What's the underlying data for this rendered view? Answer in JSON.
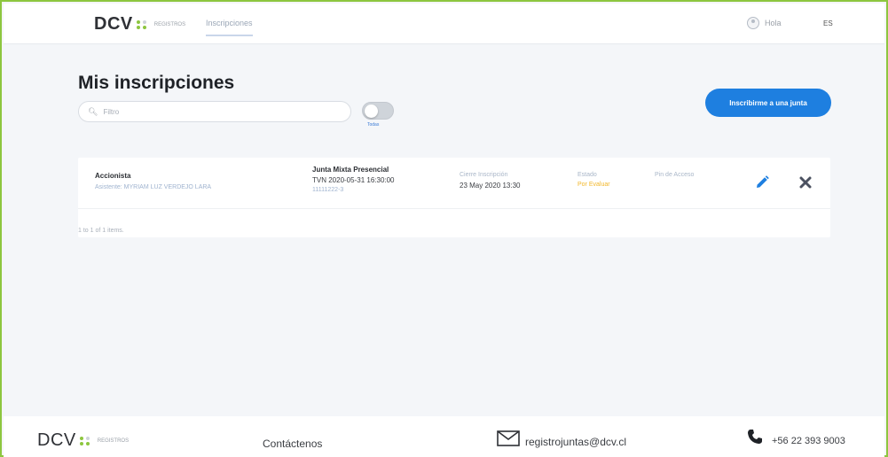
{
  "nav": {
    "logo": "DCV",
    "logo_sub": "REGISTROS",
    "tab": "Inscripciones",
    "user_label": "Hola",
    "lang": "ES"
  },
  "page": {
    "title": "Mis inscripciones",
    "search_placeholder": "Filtro",
    "toggle_label": "Todas",
    "cta": "Inscribirme a una junta"
  },
  "table": {
    "rows": [
      {
        "role": "Accionista",
        "attendee": "Asistente: MYRIAM LUZ VERDEJO LARA",
        "junta_type": "Junta Mixta Presencial",
        "junta_line": "TVN 2020-05-31 16:30:00",
        "junta_id": "11111222-3",
        "cierre_label": "Cierre Inscripción",
        "cierre_value": "23 May 2020 13:30",
        "estado_label": "Estado",
        "estado_value": "Por Evaluar",
        "pin_label": "Pin de Acceso"
      }
    ],
    "count_text": "1 to 1 of 1 items."
  },
  "footer": {
    "logo": "DCV",
    "logo_sub": "REGISTROS",
    "contact_label": "Contáctenos",
    "email": "registrojuntas@dcv.cl",
    "phone": "+56 22 393 9003"
  },
  "colors": {
    "accent": "#1e7fe0",
    "status_pending": "#f2b72b",
    "brand_green": "#8dc63f"
  },
  "icons": [
    "user-icon",
    "search-icon",
    "pencil-icon",
    "close-icon",
    "mail-icon",
    "phone-icon"
  ]
}
